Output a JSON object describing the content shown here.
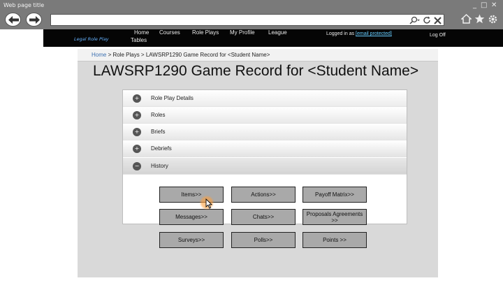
{
  "browser": {
    "window_title": "Web page title",
    "url": "",
    "controls": [
      "minimize-icon",
      "maximize-icon",
      "close-icon"
    ]
  },
  "site": {
    "logo": "Legal Role Play",
    "nav": [
      "Home",
      "Courses",
      "Role Plays",
      "My Profile",
      "League",
      "Tables"
    ],
    "logged_in_prefix": "Logged in as",
    "logged_in_email": "[email protected]",
    "logout": "Log Off"
  },
  "breadcrumb": {
    "home": "Home",
    "rest": " > Role Plays > LAWSRP1290 Game Record for <Student Name>"
  },
  "page_title": "LAWSRP1290 Game Record for <Student Name>",
  "accordion": {
    "items": [
      {
        "label": "Role Play Details",
        "icon": "+"
      },
      {
        "label": "Roles",
        "icon": "+"
      },
      {
        "label": "Briefs",
        "icon": "+"
      },
      {
        "label": "Debriefs",
        "icon": "+"
      },
      {
        "label": "History",
        "icon": "−"
      }
    ]
  },
  "buttons": {
    "items": "Items>>",
    "actions": "Actions>>",
    "payoff": "Payoff Matrix>>",
    "messages": "Messages>>",
    "chats": "Chats>>",
    "proposals": "Proposals Agreements >>",
    "surveys": "Surveys>>",
    "polls": "Polls>>",
    "points": "Points >>"
  }
}
